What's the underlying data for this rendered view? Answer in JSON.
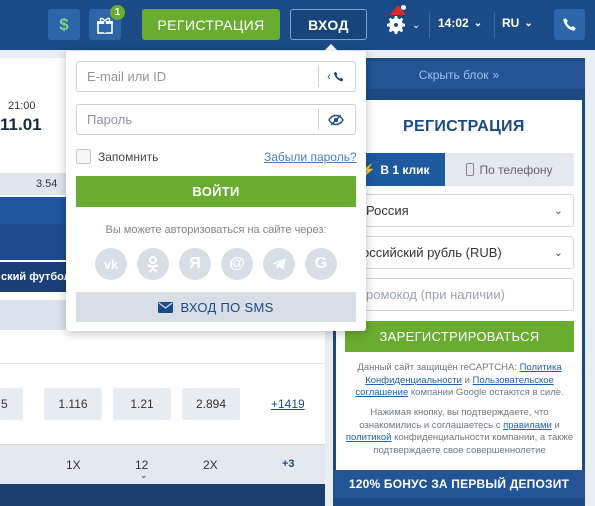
{
  "header": {
    "currency_symbol": "$",
    "gift_count": "1",
    "register_label": "РЕГИСТРАЦИЯ",
    "login_label": "ВХОД",
    "time": "14:02",
    "lang": "RU"
  },
  "background": {
    "match_time": "21:00",
    "match_date": "11.01",
    "odd_a": "3.54",
    "sport_tab": "ский футбол",
    "odd_edge": "5",
    "odds": [
      "1.116",
      "1.21",
      "2.894"
    ],
    "more_link": "+1419",
    "bottom_cols": [
      "1X",
      "12",
      "2X",
      "+3"
    ]
  },
  "login_popup": {
    "email_placeholder": "E-mail или ID",
    "password_placeholder": "Пароль",
    "remember_label": "Запомнить",
    "forgot_link": "Забыли пароль?",
    "submit_label": "ВОЙТИ",
    "social_caption": "Вы можете авторизоваться на сайте через:",
    "social": [
      "vk-icon",
      "odnoklassniki-icon",
      "yandex-icon",
      "mail-icon",
      "telegram-icon",
      "google-icon"
    ],
    "sms_label": "ВХОД ПО SMS"
  },
  "registration": {
    "hide_block": "Скрыть блок",
    "title": "РЕГИСТРАЦИЯ",
    "tab_oneclick": "В 1 клик",
    "tab_phone": "По телефону",
    "country": "Россия",
    "currency": "оссийский рубль (RUB)",
    "promo_placeholder": "ромокод (при наличии)",
    "submit_label": "ЗАРЕГИСТРИРОВАТЬСЯ",
    "recaptcha_prefix": "Данный сайт защищён reCAPTCHA:",
    "privacy_policy": "Политика Конфиденциальности",
    "and": "и",
    "user_agreement": "Пользовательское соглашение",
    "recaptcha_suffix": "компании Google остаются в силе.",
    "terms_prefix": "Нажимая кнопку, вы подтверждаете, что ознакомились и соглашаетесь с",
    "rules_link": "правилами",
    "and2": "и",
    "policy_link": "политикой",
    "terms_suffix": "конфиденциальности компании, а также подтверждаете свое совершеннолетие",
    "bonus": "120% БОНУС ЗА ПЕРВЫЙ ДЕПОЗИТ"
  },
  "colors": {
    "header_blue": "#1a4b86",
    "accent_green": "#6aac2f",
    "panel_blue": "#1d4a84"
  }
}
